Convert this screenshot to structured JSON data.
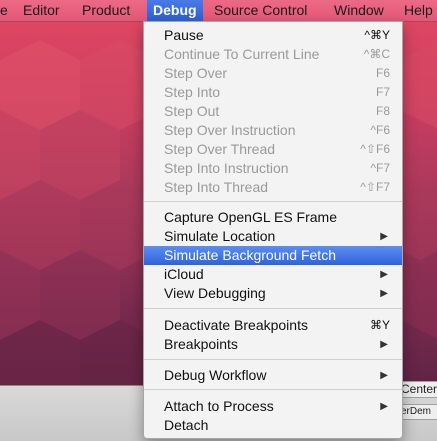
{
  "menubar": {
    "items": [
      {
        "label": "e"
      },
      {
        "label": "Editor"
      },
      {
        "label": "Product"
      },
      {
        "label": "Debug"
      },
      {
        "label": "Source Control"
      },
      {
        "label": "Window"
      },
      {
        "label": "Help"
      }
    ]
  },
  "debug_menu": {
    "pause": {
      "label": "Pause",
      "shortcut": "^⌘Y"
    },
    "continue_to_line": {
      "label": "Continue To Current Line",
      "shortcut": "^⌘C"
    },
    "step_over": {
      "label": "Step Over",
      "shortcut": "F6"
    },
    "step_into": {
      "label": "Step Into",
      "shortcut": "F7"
    },
    "step_out": {
      "label": "Step Out",
      "shortcut": "F8"
    },
    "step_over_instruction": {
      "label": "Step Over Instruction",
      "shortcut": "^F6"
    },
    "step_over_thread": {
      "label": "Step Over Thread",
      "shortcut": "^⇧F6"
    },
    "step_into_instruction": {
      "label": "Step Into Instruction",
      "shortcut": "^F7"
    },
    "step_into_thread": {
      "label": "Step Into Thread",
      "shortcut": "^⇧F7"
    },
    "capture_opengl": {
      "label": "Capture OpenGL ES Frame"
    },
    "simulate_location": {
      "label": "Simulate Location",
      "arrow": "▶"
    },
    "simulate_background_fetch": {
      "label": "Simulate Background Fetch"
    },
    "icloud": {
      "label": "iCloud",
      "arrow": "▶"
    },
    "view_debugging": {
      "label": "View Debugging",
      "arrow": "▶"
    },
    "deactivate_breakpoints": {
      "label": "Deactivate Breakpoints",
      "shortcut": "⌘Y"
    },
    "breakpoints": {
      "label": "Breakpoints",
      "arrow": "▶"
    },
    "debug_workflow": {
      "label": "Debug Workflow",
      "arrow": "▶"
    },
    "attach_to_process": {
      "label": "Attach to Process",
      "arrow": "▶"
    },
    "detach": {
      "label": "Detach"
    }
  },
  "background": {
    "fragment_1": "Center",
    "fragment_2": "erDem"
  }
}
